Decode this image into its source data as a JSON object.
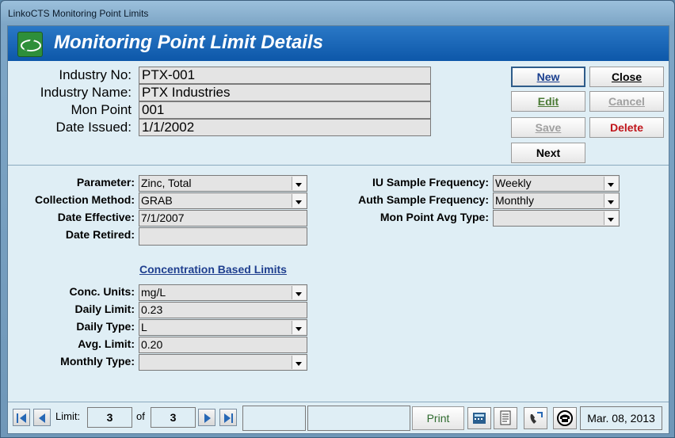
{
  "window": {
    "title": "LinkoCTS Monitoring Point Limits"
  },
  "header": {
    "title": "Monitoring Point Limit Details"
  },
  "top_fields": {
    "industry_no": {
      "label": "Industry No:",
      "value": "PTX-001"
    },
    "industry_name": {
      "label": "Industry Name:",
      "value": "PTX Industries"
    },
    "mon_point": {
      "label": "Mon Point",
      "value": "001"
    },
    "date_issued": {
      "label": "Date Issued:",
      "value": "1/1/2002"
    }
  },
  "buttons": {
    "new": "New",
    "close": "Close",
    "edit": "Edit",
    "cancel": "Cancel",
    "save": "Save",
    "delete": "Delete",
    "next": "Next"
  },
  "limit_fields": {
    "parameter": {
      "label": "Parameter:",
      "value": "Zinc, Total"
    },
    "collection_method": {
      "label": "Collection Method:",
      "value": "GRAB"
    },
    "date_effective": {
      "label": "Date Effective:",
      "value": "7/1/2007"
    },
    "date_retired": {
      "label": "Date Retired:",
      "value": ""
    },
    "iu_sample_freq": {
      "label": "IU Sample Frequency:",
      "value": "Weekly"
    },
    "auth_sample_freq": {
      "label": "Auth Sample Frequency:",
      "value": "Monthly"
    },
    "mon_point_avg_type": {
      "label": "Mon Point Avg Type:",
      "value": ""
    }
  },
  "concentration": {
    "heading": "Concentration Based Limits",
    "conc_units": {
      "label": "Conc. Units:",
      "value": "mg/L"
    },
    "daily_limit": {
      "label": "Daily Limit:",
      "value": "0.23"
    },
    "daily_type": {
      "label": "Daily Type:",
      "value": "L"
    },
    "avg_limit": {
      "label": "Avg. Limit:",
      "value": "0.20"
    },
    "monthly_type": {
      "label": "Monthly Type:",
      "value": ""
    }
  },
  "statusbar": {
    "limit_label": "Limit:",
    "current": "3",
    "of_label": "of",
    "total": "3",
    "print": "Print",
    "date": "Mar. 08, 2013"
  },
  "colors": {
    "header_blue": "#0d57a9",
    "client_bg": "#dfeef5",
    "delete_red": "#c0151b",
    "edit_green": "#4a7a34",
    "link_blue": "#1f3f8f"
  },
  "icons": [
    "calculator-icon",
    "document-icon",
    "phone-handset-icon",
    "telephone-icon"
  ]
}
